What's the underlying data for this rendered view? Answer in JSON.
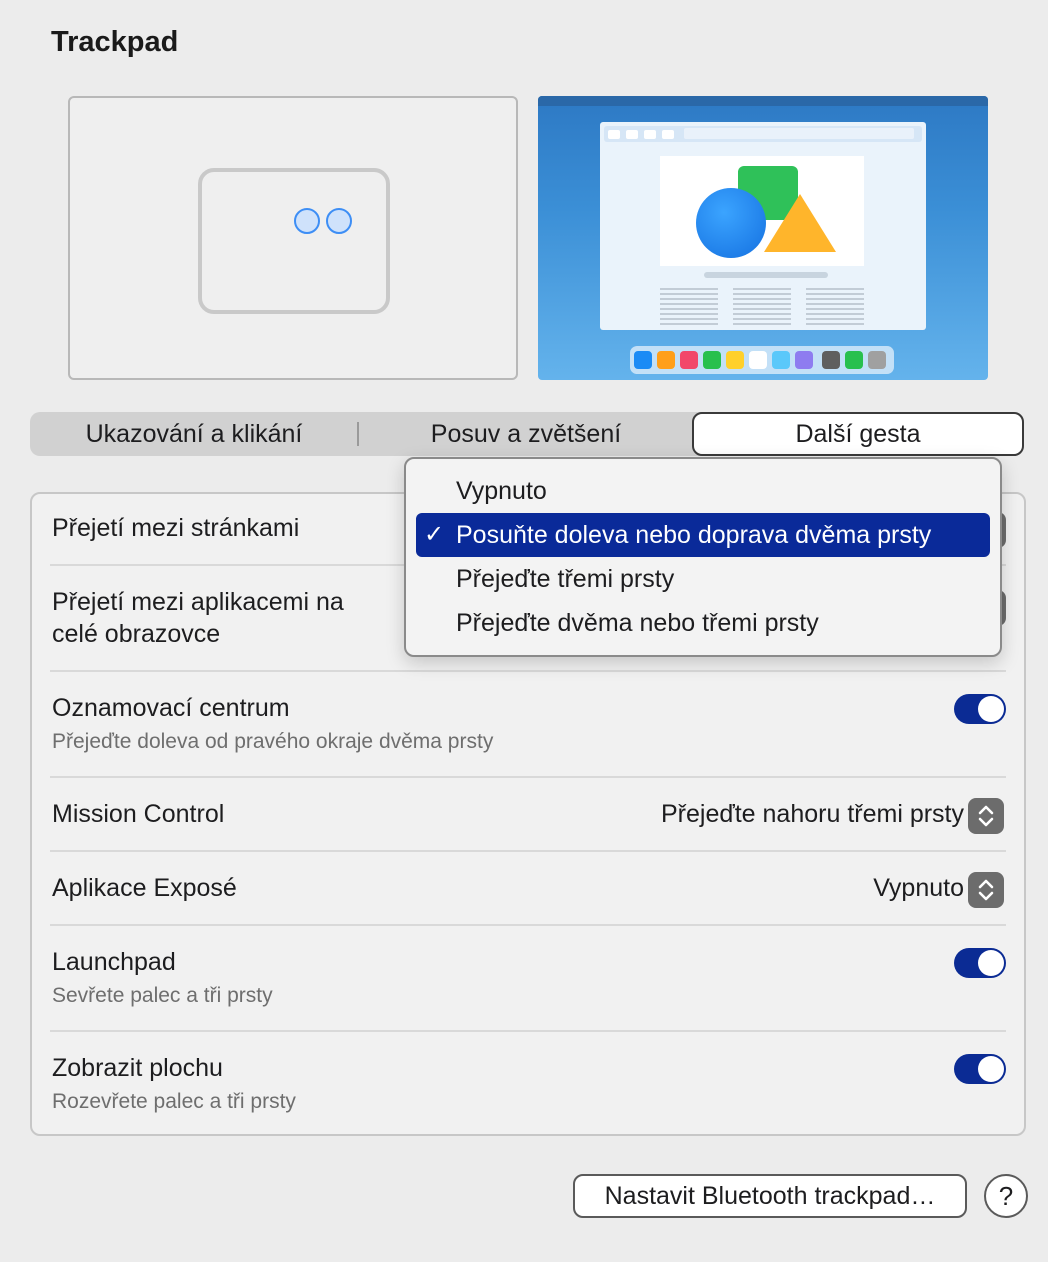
{
  "title": "Trackpad",
  "tabs": [
    {
      "label": "Ukazování a klikání",
      "active": false
    },
    {
      "label": "Posuv a zvětšení",
      "active": false
    },
    {
      "label": "Další gesta",
      "active": true
    }
  ],
  "dropdown": {
    "options": [
      "Vypnuto",
      "Posuňte doleva nebo doprava dvěma prsty",
      "Přejeďte třemi prsty",
      "Přejeďte dvěma nebo třemi prsty"
    ],
    "selected_index": 1,
    "check_glyph": "✓"
  },
  "settings": [
    {
      "label": "Přejetí mezi stránkami"
    },
    {
      "label_line1": "Přejetí mezi aplikacemi na",
      "label_line2": "celé obrazovce"
    },
    {
      "label": "Oznamovací centrum",
      "sub": "Přejeďte doleva od pravého okraje dvěma prsty",
      "toggle": true
    },
    {
      "label": "Mission Control",
      "value": "Přejeďte nahoru třemi prsty"
    },
    {
      "label": "Aplikace Exposé",
      "value": "Vypnuto"
    },
    {
      "label": "Launchpad",
      "sub": "Sevřete palec a tři prsty",
      "toggle": true
    },
    {
      "label": "Zobrazit plochu",
      "sub": "Rozevřete palec a tři prsty",
      "toggle": true
    }
  ],
  "buttons": {
    "bluetooth": "Nastavit Bluetooth trackpad…",
    "help": "?"
  },
  "colors": {
    "accent": "#0a2a99",
    "toggle_on": "#0b2b94",
    "background": "#ececec"
  }
}
